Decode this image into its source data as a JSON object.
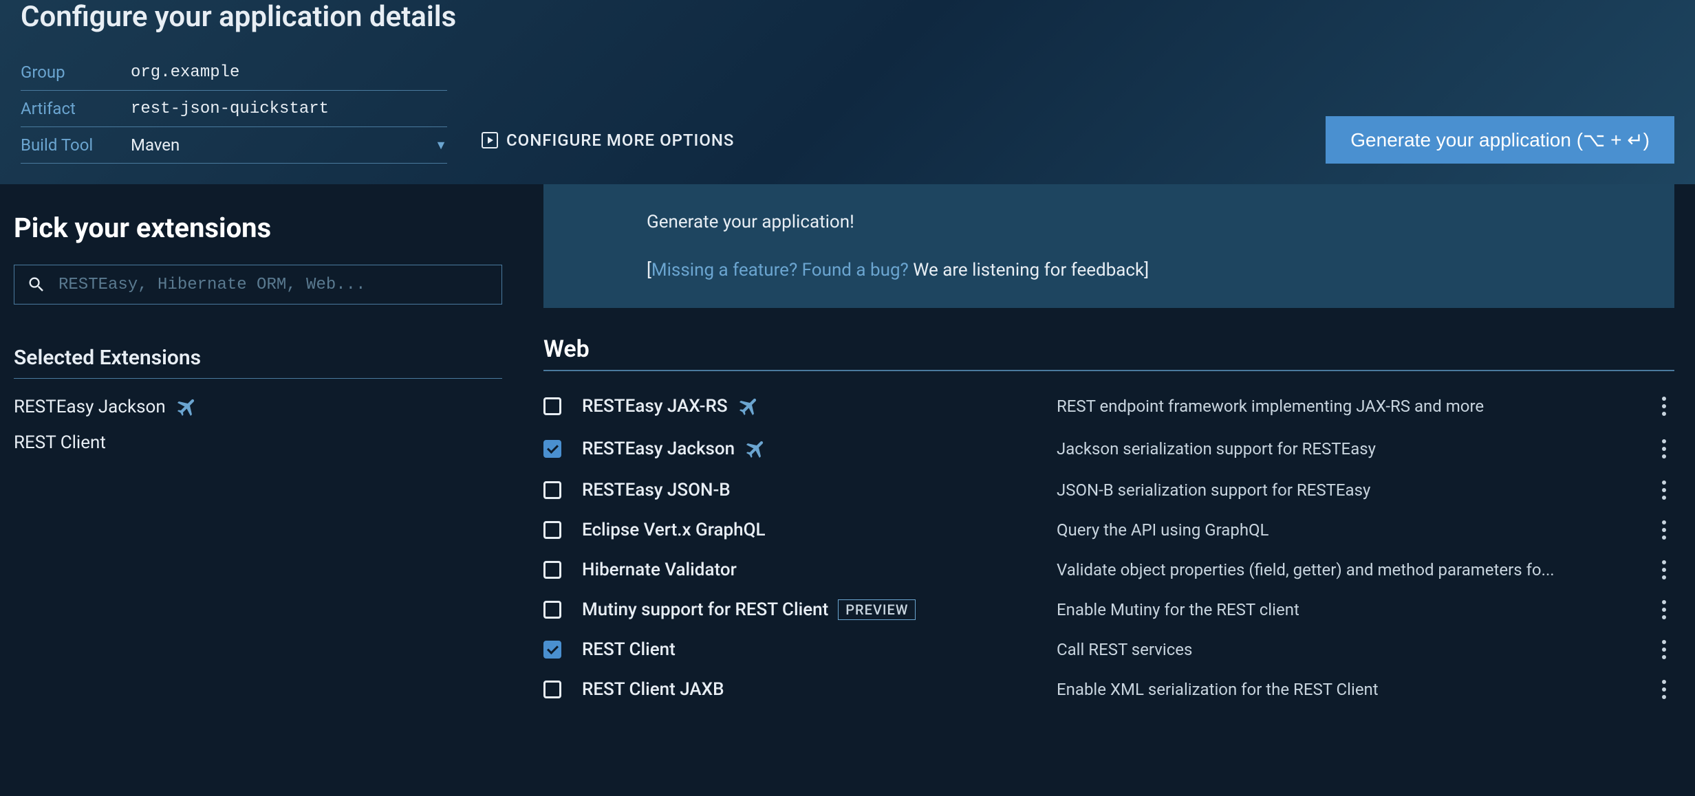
{
  "header": {
    "title": "Configure your application details",
    "fields": {
      "group_label": "Group",
      "group_value": "org.example",
      "artifact_label": "Artifact",
      "artifact_value": "rest-json-quickstart",
      "buildtool_label": "Build Tool",
      "buildtool_value": "Maven"
    },
    "more_options": "CONFIGURE MORE OPTIONS",
    "generate_btn": "Generate your application (⌥ + ↵)"
  },
  "banner": {
    "line1": "Generate your application!",
    "bracket_open": "[",
    "link": "Missing a feature? Found a bug?",
    "tail": " We are listening for feedback]",
    "colors": {
      "link": "#6ba5d0"
    }
  },
  "sidebar": {
    "pick_title": "Pick your extensions",
    "search_placeholder": "RESTEasy, Hibernate ORM, Web...",
    "selected_title": "Selected Extensions",
    "selected": [
      {
        "name": "RESTEasy Jackson",
        "icon": "plane"
      },
      {
        "name": "REST Client",
        "icon": null
      }
    ]
  },
  "category": {
    "title": "Web",
    "items": [
      {
        "checked": false,
        "name": "RESTEasy JAX-RS",
        "icon": "plane",
        "badge": null,
        "desc": "REST endpoint framework implementing JAX-RS and more"
      },
      {
        "checked": true,
        "name": "RESTEasy Jackson",
        "icon": "plane",
        "badge": null,
        "desc": "Jackson serialization support for RESTEasy"
      },
      {
        "checked": false,
        "name": "RESTEasy JSON-B",
        "icon": null,
        "badge": null,
        "desc": "JSON-B serialization support for RESTEasy"
      },
      {
        "checked": false,
        "name": "Eclipse Vert.x GraphQL",
        "icon": null,
        "badge": null,
        "desc": "Query the API using GraphQL"
      },
      {
        "checked": false,
        "name": "Hibernate Validator",
        "icon": null,
        "badge": null,
        "desc": "Validate object properties (field, getter) and method parameters fo..."
      },
      {
        "checked": false,
        "name": "Mutiny support for REST Client",
        "icon": null,
        "badge": "PREVIEW",
        "desc": "Enable Mutiny for the REST client"
      },
      {
        "checked": true,
        "name": "REST Client",
        "icon": null,
        "badge": null,
        "desc": "Call REST services"
      },
      {
        "checked": false,
        "name": "REST Client JAXB",
        "icon": null,
        "badge": null,
        "desc": "Enable XML serialization for the REST Client"
      }
    ]
  }
}
